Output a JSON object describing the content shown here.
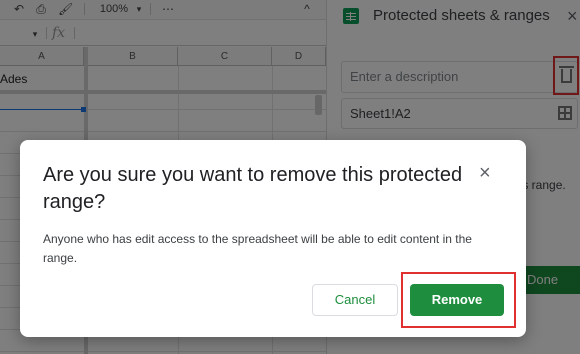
{
  "toolbar": {
    "undo_icon": "undo-icon",
    "print_icon": "print-icon",
    "paint_icon": "paint-format-icon",
    "zoom": "100%",
    "more": "⋯",
    "collapse": "^"
  },
  "formula_bar": {
    "fx": "fx"
  },
  "grid": {
    "columns": [
      "A",
      "B",
      "C",
      "D"
    ],
    "cell_a1": "Ades"
  },
  "panel": {
    "title": "Protected sheets & ranges",
    "close": "×",
    "description_placeholder": "Enter a description",
    "range": "Sheet1!A2",
    "snippet": "his range.",
    "done_label": "Done"
  },
  "dialog": {
    "title": "Are you sure you want to remove this protected range?",
    "close": "×",
    "body": "Anyone who has edit access to the spreadsheet will be able to edit content in the range.",
    "cancel_label": "Cancel",
    "remove_label": "Remove"
  },
  "colors": {
    "accent_green": "#1e8e3e",
    "highlight_red": "#e03030"
  }
}
